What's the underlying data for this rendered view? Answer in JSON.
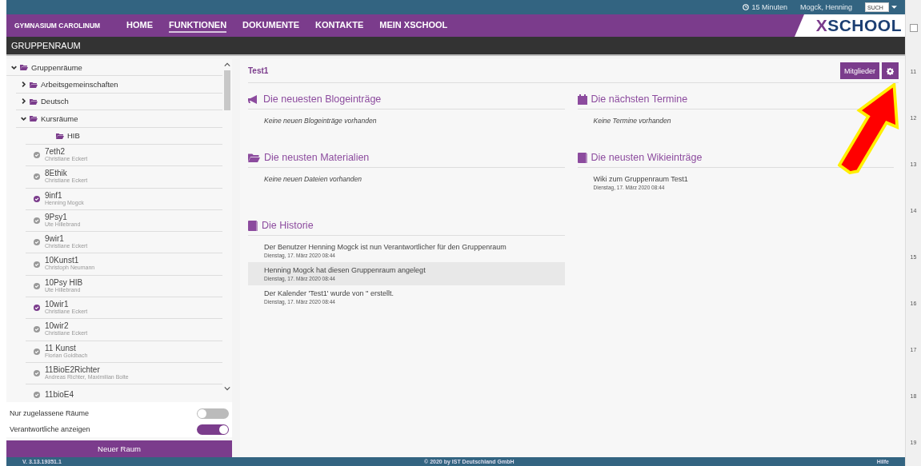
{
  "topbar": {
    "timer": "15 Minuten",
    "user": "Mogck, Henning",
    "search_placeholder": "SUCH"
  },
  "nav": {
    "school": "GYMNASIUM CAROLINUM",
    "items": [
      {
        "label": "HOME",
        "selected": false
      },
      {
        "label": "FUNKTIONEN",
        "selected": true
      },
      {
        "label": "DOKUMENTE",
        "selected": false
      },
      {
        "label": "KONTAKTE",
        "selected": false
      },
      {
        "label": "MEIN XSCHOOL",
        "selected": false
      }
    ],
    "logo": "XSCHOOL"
  },
  "page_title": "GRUPPENRAUM",
  "sidebar": {
    "tree": [
      {
        "kind": "folder",
        "label": "Gruppenräume",
        "expanded": true,
        "children": [
          {
            "kind": "folder",
            "label": "Arbeitsgemeinschaften",
            "expanded": false
          },
          {
            "kind": "folder",
            "label": "Deutsch",
            "expanded": false
          },
          {
            "kind": "folder",
            "label": "Kursräume",
            "expanded": true,
            "children": [
              {
                "kind": "leaf-folder",
                "label": "HIB"
              },
              {
                "kind": "room",
                "label": "7eth2",
                "owner": "Christiane Eckert",
                "checked": false
              },
              {
                "kind": "room",
                "label": "8Ethik",
                "owner": "Christiane Eckert",
                "checked": false
              },
              {
                "kind": "room",
                "label": "9inf1",
                "owner": "Henning Mogck",
                "checked": true
              },
              {
                "kind": "room",
                "label": "9Psy1",
                "owner": "Ute Hillebrand",
                "checked": false
              },
              {
                "kind": "room",
                "label": "9wir1",
                "owner": "Christiane Eckert",
                "checked": false
              },
              {
                "kind": "room",
                "label": "10Kunst1",
                "owner": "Christoph Neumann",
                "checked": false
              },
              {
                "kind": "room",
                "label": "10Psy HIB",
                "owner": "Ute Hillebrand",
                "checked": false
              },
              {
                "kind": "room",
                "label": "10wir1",
                "owner": "Christiane Eckert",
                "checked": true
              },
              {
                "kind": "room",
                "label": "10wir2",
                "owner": "Christiane Eckert",
                "checked": false
              },
              {
                "kind": "room",
                "label": "11 Kunst",
                "owner": "Florian Goldbach",
                "checked": false
              },
              {
                "kind": "room",
                "label": "11BioE2Richter",
                "owner": "Andreas Richter, Maximilian Bolte",
                "checked": false
              },
              {
                "kind": "room",
                "label": "11bioE4",
                "checked": false
              }
            ]
          }
        ]
      }
    ],
    "toggles": [
      {
        "label": "Nur zugelassene Räume",
        "on": false
      },
      {
        "label": "Verantwortliche anzeigen",
        "on": true
      }
    ],
    "new_button": "Neuer Raum"
  },
  "main": {
    "title": "Test1",
    "members_button": "Mitglieder",
    "columns": [
      [
        {
          "title": "Die neuesten Blogeinträge",
          "empty": "Keine neuen Blogeinträge vorhanden"
        },
        {
          "title": "Die neusten Materialien",
          "empty": "Keine neuen Dateien vorhanden"
        },
        {
          "title": "Die Historie",
          "entries": [
            {
              "text": "Der Benutzer Henning Mogck ist nun Verantwortlicher für den Gruppenraum",
              "date": "Dienstag, 17. März 2020 08:44",
              "selected": false
            },
            {
              "text": "Henning Mogck hat diesen Gruppenraum angelegt",
              "date": "Dienstag, 17. März 2020 08:44",
              "selected": true
            },
            {
              "text": "Der Kalender 'Test1' wurde von '' erstellt.",
              "date": "Dienstag, 17. März 2020 08:44",
              "selected": false
            }
          ]
        }
      ],
      [
        {
          "title": "Die nächsten Termine",
          "empty": "Keine Termine vorhanden"
        },
        {
          "title": "Die neusten Wikieinträge",
          "entries": [
            {
              "text": "Wiki zum Gruppenraum Test1",
              "date": "Dienstag, 17. März 2020 08:44",
              "selected": false
            }
          ]
        }
      ]
    ]
  },
  "footer": {
    "version": "V. 3.13.19351.1",
    "copyright": "© 2020 by IST Deutschland GmbH",
    "help": "Hilfe"
  },
  "ruler": {
    "labels": [
      "11",
      "12",
      "13",
      "14",
      "15",
      "16",
      "17",
      "18",
      "19"
    ]
  }
}
